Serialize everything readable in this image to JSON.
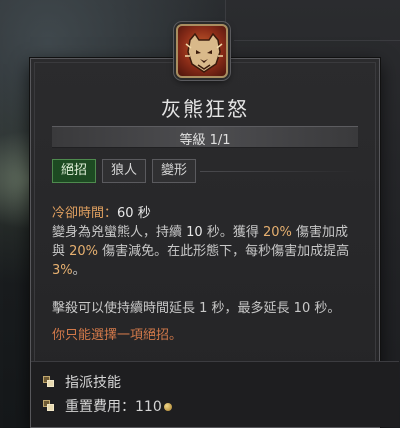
{
  "skill": {
    "name": "灰熊狂怒",
    "rank": "等級 1/1",
    "icon": "grizzly-rage-icon"
  },
  "tags": [
    {
      "label": "絕招",
      "active": true
    },
    {
      "label": "狼人",
      "active": false
    },
    {
      "label": "變形",
      "active": false
    }
  ],
  "description": {
    "cooldown_label": "冷卻時間：",
    "cooldown_value": "60 秒",
    "line1_a": "變身為兇蠻熊人，持續 ",
    "line1_num": "10",
    "line1_b": " 秒。獲得 ",
    "line1_pct": "20%",
    "line1_c": " 傷害加成",
    "line2_a": "與 ",
    "line2_pct": "20%",
    "line2_b": " 傷害減免。在此形態下，每秒傷害加成提高",
    "line3_pct": "3%",
    "line3_b": "。",
    "para2": "擊殺可以使持續時間延長 1 秒，最多延長 10 秒。",
    "warning": "你只能選擇一項絕招。"
  },
  "footer": {
    "assign_label": "指派技能",
    "respec_label": "重置費用：",
    "respec_cost": "110"
  },
  "colors": {
    "active_tag": "#1d4a22",
    "warning": "#d2794a",
    "cooldown_label": "#e0a060"
  }
}
